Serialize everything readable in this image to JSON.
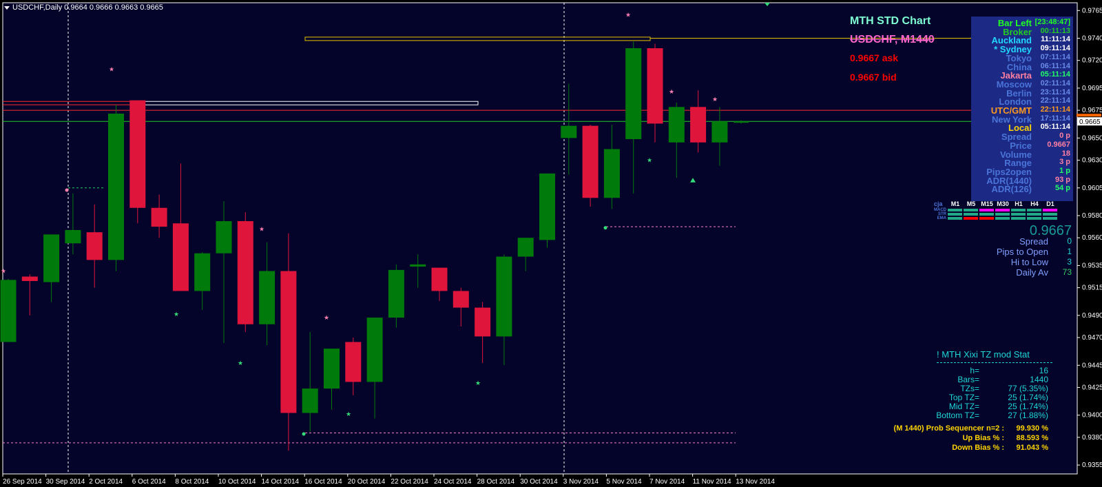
{
  "header": {
    "symbol_line": "USDCHF,Daily  0.9664 0.9666 0.9663 0.9665"
  },
  "colors": {
    "background": "#04042a",
    "bull": "#007a0a",
    "bear": "#e0153c",
    "grid": "#ffffff",
    "panel": "#1c2a86",
    "price_tag": "#ff6600"
  },
  "chart_data": {
    "type": "candlestick",
    "ylim": [
      0.9347,
      0.9772
    ],
    "yticks": [
      "0.9765",
      "0.9740",
      "0.9720",
      "0.9695",
      "0.9675",
      "0.9650",
      "0.9630",
      "0.9605",
      "0.9580",
      "0.9560",
      "0.9535",
      "0.9515",
      "0.9490",
      "0.9470",
      "0.9445",
      "0.9425",
      "0.9400",
      "0.9380",
      "0.9355"
    ],
    "xticks": [
      "26 Sep 2014",
      "30 Sep 2014",
      "2 Oct 2014",
      "6 Oct 2014",
      "8 Oct 2014",
      "10 Oct 2014",
      "14 Oct 2014",
      "16 Oct 2014",
      "20 Oct 2014",
      "22 Oct 2014",
      "24 Oct 2014",
      "28 Oct 2014",
      "30 Oct 2014",
      "3 Nov 2014",
      "5 Nov 2014",
      "7 Nov 2014",
      "11 Nov 2014",
      "13 Nov 2014"
    ],
    "current_price": "0.9665",
    "candles": [
      {
        "o": 0.9466,
        "h": 0.9523,
        "l": 0.9466,
        "c": 0.9522
      },
      {
        "o": 0.9525,
        "h": 0.9527,
        "l": 0.949,
        "c": 0.9521
      },
      {
        "o": 0.952,
        "h": 0.954,
        "l": 0.9502,
        "c": 0.9563
      },
      {
        "o": 0.9555,
        "h": 0.96,
        "l": 0.9545,
        "c": 0.9567
      },
      {
        "o": 0.9565,
        "h": 0.959,
        "l": 0.9515,
        "c": 0.954
      },
      {
        "o": 0.954,
        "h": 0.968,
        "l": 0.953,
        "c": 0.9672
      },
      {
        "o": 0.9684,
        "h": 0.9684,
        "l": 0.9573,
        "c": 0.9587
      },
      {
        "o": 0.9587,
        "h": 0.9599,
        "l": 0.956,
        "c": 0.957
      },
      {
        "o": 0.9573,
        "h": 0.9627,
        "l": 0.9514,
        "c": 0.9512
      },
      {
        "o": 0.9512,
        "h": 0.9547,
        "l": 0.9495,
        "c": 0.9546
      },
      {
        "o": 0.9546,
        "h": 0.9593,
        "l": 0.9465,
        "c": 0.9575
      },
      {
        "o": 0.9575,
        "h": 0.9583,
        "l": 0.9475,
        "c": 0.9482
      },
      {
        "o": 0.9482,
        "h": 0.9556,
        "l": 0.9463,
        "c": 0.953
      },
      {
        "o": 0.953,
        "h": 0.9564,
        "l": 0.9368,
        "c": 0.9402
      },
      {
        "o": 0.9402,
        "h": 0.9475,
        "l": 0.9385,
        "c": 0.9424
      },
      {
        "o": 0.9424,
        "h": 0.9456,
        "l": 0.9405,
        "c": 0.946
      },
      {
        "o": 0.9466,
        "h": 0.947,
        "l": 0.9418,
        "c": 0.943
      },
      {
        "o": 0.943,
        "h": 0.947,
        "l": 0.9397,
        "c": 0.9488
      },
      {
        "o": 0.9488,
        "h": 0.9536,
        "l": 0.9479,
        "c": 0.9531
      },
      {
        "o": 0.9534,
        "h": 0.9545,
        "l": 0.9515,
        "c": 0.9536
      },
      {
        "o": 0.9533,
        "h": 0.9533,
        "l": 0.9503,
        "c": 0.9512
      },
      {
        "o": 0.9512,
        "h": 0.9515,
        "l": 0.948,
        "c": 0.9497
      },
      {
        "o": 0.9497,
        "h": 0.9502,
        "l": 0.9447,
        "c": 0.9471
      },
      {
        "o": 0.9471,
        "h": 0.9545,
        "l": 0.9445,
        "c": 0.9543
      },
      {
        "o": 0.9543,
        "h": 0.9557,
        "l": 0.953,
        "c": 0.956
      },
      {
        "o": 0.9558,
        "h": 0.9618,
        "l": 0.9551,
        "c": 0.9618
      },
      {
        "o": 0.965,
        "h": 0.9699,
        "l": 0.9617,
        "c": 0.9661
      },
      {
        "o": 0.9661,
        "h": 0.9662,
        "l": 0.9588,
        "c": 0.9596
      },
      {
        "o": 0.9596,
        "h": 0.9662,
        "l": 0.9586,
        "c": 0.964
      },
      {
        "o": 0.9649,
        "h": 0.9737,
        "l": 0.96,
        "c": 0.9731
      },
      {
        "o": 0.9731,
        "h": 0.9735,
        "l": 0.9646,
        "c": 0.9663
      },
      {
        "o": 0.9646,
        "h": 0.9682,
        "l": 0.9614,
        "c": 0.9678
      },
      {
        "o": 0.9678,
        "h": 0.9693,
        "l": 0.9637,
        "c": 0.9646
      },
      {
        "o": 0.9646,
        "h": 0.9678,
        "l": 0.9625,
        "c": 0.9665
      },
      {
        "o": 0.9664,
        "h": 0.9666,
        "l": 0.9663,
        "c": 0.9665
      }
    ]
  },
  "mth": {
    "title": "MTH STD Chart",
    "symbol": "USDCHF, M1440",
    "ask": "0.9667 ask",
    "bid": "0.9667 bid"
  },
  "tz_panel": {
    "rows": [
      {
        "label": "Bar Left",
        "value": "[23:48:47]",
        "label_color": "#22ff22",
        "value_color": "#22ff22"
      },
      {
        "label": "Broker",
        "value": "00:11:13",
        "label_color": "#22cc22",
        "value_color": "#22cc22"
      },
      {
        "label": "Auckland",
        "value": "11:11:14",
        "label_color": "#22d8ff",
        "value_color": "#ffffff"
      },
      {
        "label": "* Sydney",
        "value": "09:11:14",
        "label_color": "#22d8ff",
        "value_color": "#ffffff"
      },
      {
        "label": "Tokyo",
        "value": "07:11:14",
        "label_color": "#4a74d8",
        "value_color": "#6a8ae8"
      },
      {
        "label": "China",
        "value": "06:11:14",
        "label_color": "#4a74d8",
        "value_color": "#6a8ae8"
      },
      {
        "label": "Jakarta",
        "value": "05:11:14",
        "label_color": "#ff7fa0",
        "value_color": "#22ff66"
      },
      {
        "label": "Moscow",
        "value": "02:11:14",
        "label_color": "#4a74d8",
        "value_color": "#6a8ae8"
      },
      {
        "label": "Berlin",
        "value": "23:11:14",
        "label_color": "#4a74d8",
        "value_color": "#6a8ae8"
      },
      {
        "label": "London",
        "value": "22:11:14",
        "label_color": "#4a74d8",
        "value_color": "#6a8ae8"
      },
      {
        "label": "UTC/GMT",
        "value": "22:11:14",
        "label_color": "#ff9a1f",
        "value_color": "#ff9a1f"
      },
      {
        "label": "New York",
        "value": "17:11:14",
        "label_color": "#4a74d8",
        "value_color": "#6a8ae8"
      },
      {
        "label": "Local",
        "value": "05:11:14",
        "label_color": "#ffd400",
        "value_color": "#ffffff"
      },
      {
        "label": "Spread",
        "value": "0 p",
        "label_color": "#4a74d8",
        "value_color": "#ff7fa0"
      },
      {
        "label": "Price",
        "value": "0.9667",
        "label_color": "#4a74d8",
        "value_color": "#ff7fa0"
      },
      {
        "label": "Volume",
        "value": "18",
        "label_color": "#4a74d8",
        "value_color": "#ff7fa0"
      },
      {
        "label": "Range",
        "value": "3 p",
        "label_color": "#4a74d8",
        "value_color": "#ff7fa0"
      },
      {
        "label": "Pips2open",
        "value": "1 p",
        "label_color": "#4a74d8",
        "value_color": "#22ff66"
      },
      {
        "label": "ADR(1440)",
        "value": "93 p",
        "label_color": "#4a74d8",
        "value_color": "#ff7fa0"
      },
      {
        "label": "ADR(126)",
        "value": "54 p",
        "label_color": "#4a74d8",
        "value_color": "#22ff66"
      }
    ]
  },
  "signal_grid": {
    "label": "cja",
    "timeframes": [
      "M1",
      "M5",
      "M15",
      "M30",
      "H1",
      "H4",
      "D1"
    ],
    "rows": [
      "MACD",
      "STR",
      "EMA"
    ]
  },
  "price_box": {
    "price": "0.9667",
    "rows": [
      {
        "label": "Spread",
        "value": "0"
      },
      {
        "label": "Pips to Open",
        "value": "1"
      },
      {
        "label": "Hi to Low",
        "value": "3"
      },
      {
        "label": "Daily Av",
        "value": "73"
      }
    ]
  },
  "stats": {
    "title": "! MTH Xixi TZ mod Stat",
    "rows": [
      {
        "label": "h=",
        "value": "16"
      },
      {
        "label": "Bars=",
        "value": "1440"
      },
      {
        "label": "TZs=",
        "value": "77 (5.35%)"
      },
      {
        "label": "Top TZ=",
        "value": "25 (1.74%)"
      },
      {
        "label": "Mid TZ=",
        "value": "25 (1.74%)"
      },
      {
        "label": "Bottom TZ=",
        "value": "27 (1.88%)"
      }
    ],
    "prob": [
      {
        "label": "(M 1440) Prob Sequencer n=2 :",
        "value": "99.930 %"
      },
      {
        "label": "Up Bias % :",
        "value": "88.593 %"
      },
      {
        "label": "Down Bias % :",
        "value": "91.043 %"
      }
    ]
  }
}
